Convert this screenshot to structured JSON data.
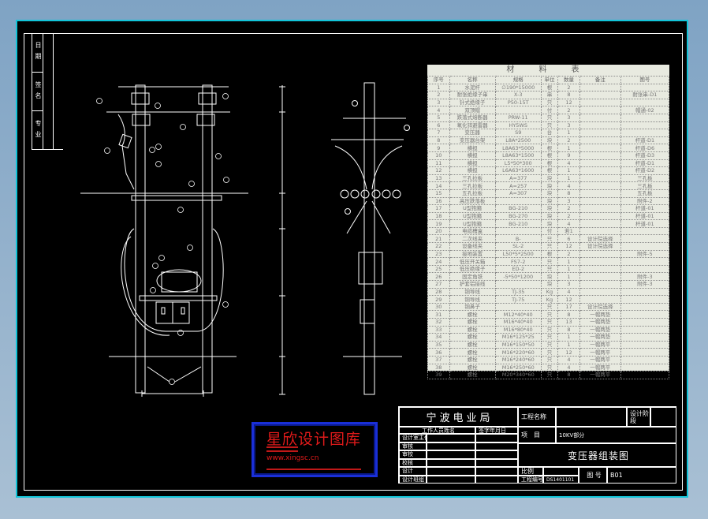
{
  "left_strip": {
    "labels": [
      "日期",
      "签名",
      "专业"
    ]
  },
  "material_table": {
    "title": "材 料 表",
    "headers": [
      "序号",
      "名称",
      "规格",
      "单位",
      "数量",
      "备注",
      "图号"
    ],
    "rows": [
      [
        "1",
        "水泥杆",
        "∅190*15000",
        "根",
        "2",
        "",
        ""
      ],
      [
        "2",
        "耐张绝缘子串",
        "X-3",
        "串",
        "8",
        "",
        "耐张串-D1"
      ],
      [
        "3",
        "针式绝缘子",
        "P50-15T",
        "只",
        "12",
        "",
        ""
      ],
      [
        "4",
        "双顶帽",
        "",
        "付",
        "2",
        "",
        "帽通-02"
      ],
      [
        "5",
        "跌落式熔断器",
        "PRW-11",
        "只",
        "3",
        "",
        ""
      ],
      [
        "6",
        "氧化锌避雷器",
        "HY5WS",
        "只",
        "3",
        "",
        ""
      ],
      [
        "7",
        "变压器",
        "S9",
        "台",
        "1",
        "",
        ""
      ],
      [
        "8",
        "变压器台架",
        "L8A*2500",
        "块",
        "2",
        "",
        "杆道-D1"
      ],
      [
        "9",
        "横担",
        "L8A63*5000",
        "根",
        "1",
        "",
        "杆道-D6"
      ],
      [
        "10",
        "横担",
        "L8A63*1500",
        "根",
        "9",
        "",
        "杆道-D3"
      ],
      [
        "11",
        "横担",
        "L5*50*300",
        "根",
        "4",
        "",
        "杆道-D1"
      ],
      [
        "12",
        "横担",
        "L6A63*1600",
        "根",
        "1",
        "",
        "杆道-D2"
      ],
      [
        "13",
        "三孔拉板",
        "A=377",
        "块",
        "1",
        "",
        "三孔板"
      ],
      [
        "14",
        "三孔拉板",
        "A=257",
        "块",
        "4",
        "",
        "三孔板"
      ],
      [
        "15",
        "五孔拉板",
        "A=307",
        "块",
        "8",
        "",
        "五孔板"
      ],
      [
        "16",
        "高压跌落板",
        "",
        "块",
        "3",
        "",
        "附件-2"
      ],
      [
        "17",
        "U型抱箍",
        "BG-210",
        "块",
        "2",
        "",
        "杆道-01"
      ],
      [
        "18",
        "U型抱箍",
        "BG-270",
        "块",
        "2",
        "",
        "杆道-01"
      ],
      [
        "19",
        "U型抱箍",
        "BG-210",
        "块",
        "4",
        "",
        "杆道-01"
      ],
      [
        "20",
        "电缆槽盒",
        "",
        "付",
        "若1",
        "",
        ""
      ],
      [
        "21",
        "二次线夹",
        "B-",
        "只",
        "6",
        "设计院选择",
        ""
      ],
      [
        "22",
        "设备线夹",
        "SL-2",
        "只",
        "12",
        "设计院选择",
        ""
      ],
      [
        "23",
        "接地装置",
        "L50*5*2500",
        "根",
        "2",
        "",
        "附件-5"
      ],
      [
        "24",
        "低压开关箱",
        "FS7-2",
        "只",
        "1",
        "",
        ""
      ],
      [
        "25",
        "低压绝缘子",
        "ED-2",
        "只",
        "1",
        "",
        ""
      ],
      [
        "26",
        "固定角铁",
        "-5*50*1200",
        "块",
        "1",
        "",
        "附件-3"
      ],
      [
        "27",
        "护套铝接线",
        "",
        "块",
        "3",
        "",
        "附件-3"
      ],
      [
        "28",
        "铜导线",
        "TJ-35",
        "Kg",
        "4",
        "",
        ""
      ],
      [
        "29",
        "铜导线",
        "TJ-75",
        "Kg",
        "12",
        "",
        ""
      ],
      [
        "30",
        "铜鼻子",
        "",
        "只",
        "17",
        "设计院选择",
        ""
      ],
      [
        "31",
        "螺栓",
        "M12*40*40",
        "只",
        "8",
        "一帽两垫",
        ""
      ],
      [
        "32",
        "螺栓",
        "M16*40*40",
        "只",
        "13",
        "一帽两垫",
        ""
      ],
      [
        "33",
        "螺栓",
        "M16*80*40",
        "只",
        "8",
        "一帽两垫",
        ""
      ],
      [
        "34",
        "螺栓",
        "M16*125*25",
        "只",
        "1",
        "一帽两垫",
        ""
      ],
      [
        "35",
        "螺栓",
        "M16*150*50",
        "只",
        "1",
        "一帽两平",
        ""
      ],
      [
        "36",
        "螺栓",
        "M16*220*60",
        "只",
        "12",
        "一帽两平",
        ""
      ],
      [
        "37",
        "螺栓",
        "M16*240*60",
        "只",
        "4",
        "一帽两平",
        ""
      ],
      [
        "38",
        "螺栓",
        "M16*250*60",
        "只",
        "4",
        "一帽两平",
        ""
      ],
      [
        "39",
        "螺栓",
        "M20*340*60",
        "只",
        "8",
        "一帽两平",
        ""
      ]
    ]
  },
  "title_block": {
    "company": "宁波电业局",
    "project_name_label": "工程名称",
    "design_stage_label": "设计阶段",
    "staff_header": "工作人员姓名",
    "date_header": "签字年月日",
    "roles": [
      "设计室主任",
      "审核",
      "审校",
      "校核",
      "设计",
      "设计班组"
    ],
    "item_label": "项　目",
    "item_value": "10KV部分",
    "drawing_title": "变压器组装图",
    "scale_label": "比例",
    "scale_value": "",
    "project_no_label": "工程编号",
    "project_no_value": "DS1401101",
    "drawing_no_label": "图 号",
    "drawing_no_value": "B01"
  },
  "watermark": {
    "title": "星欣设计图库",
    "url": "www.xingsc.cn"
  },
  "colors": {
    "frame": "#12c4d8",
    "background": "#000000",
    "lines": "#ffffff",
    "watermark_red": "#e01a1a",
    "watermark_blue": "#1a2fd8"
  }
}
